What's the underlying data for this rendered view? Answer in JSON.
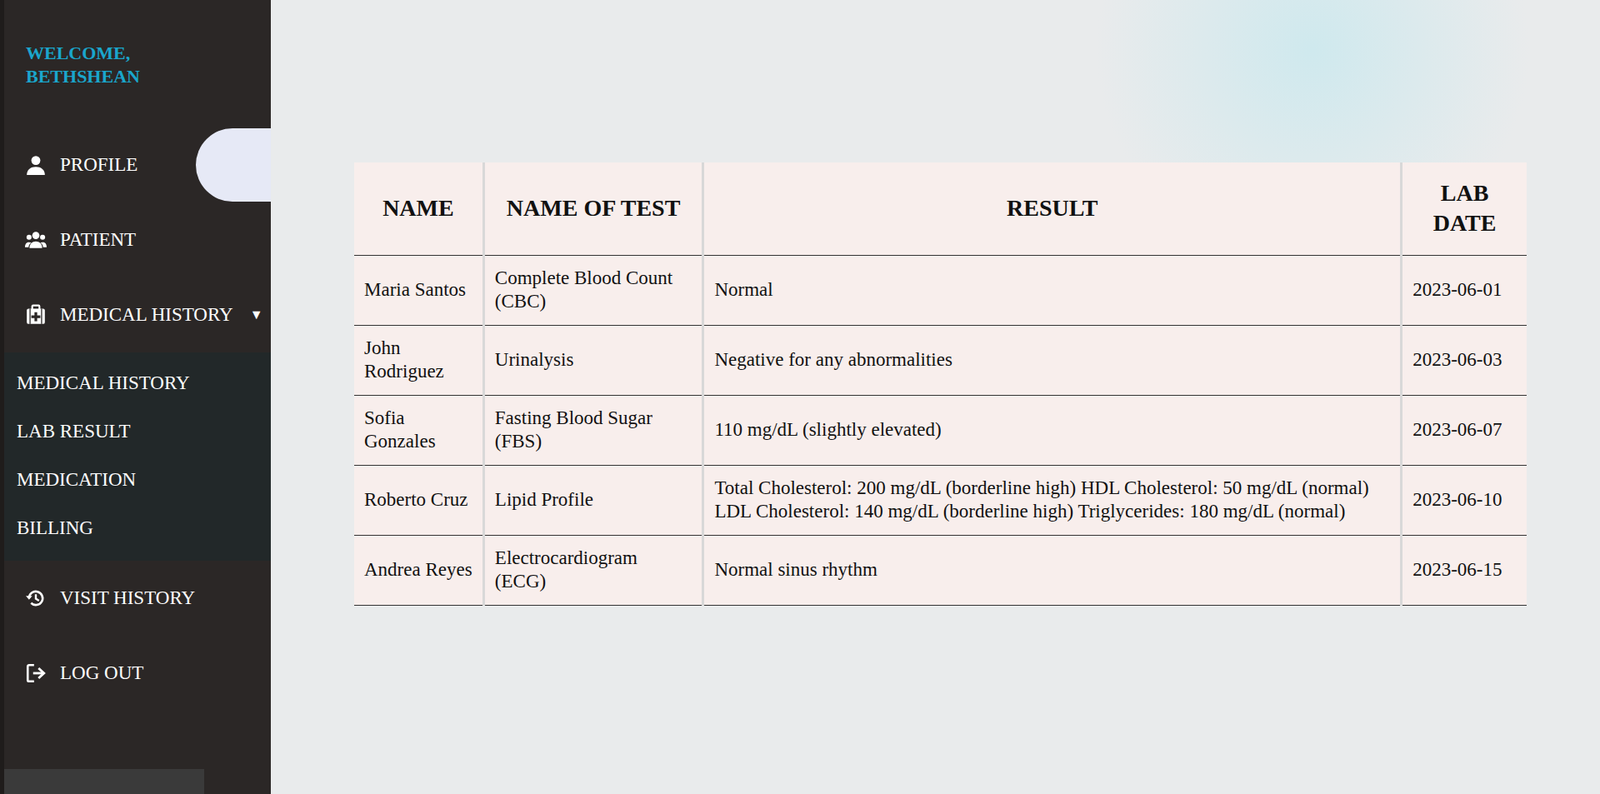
{
  "sidebar": {
    "welcome": "WELCOME, BETHSHEAN",
    "items": [
      {
        "label": "PROFILE",
        "selected": true
      },
      {
        "label": "PATIENT",
        "selected": false
      },
      {
        "label": "MEDICAL HISTORY",
        "selected": false,
        "expanded": true,
        "children": [
          "MEDICAL HISTORY",
          "LAB RESULT",
          "MEDICATION",
          "BILLING"
        ]
      },
      {
        "label": "VISIT HISTORY",
        "selected": false
      },
      {
        "label": "LOG OUT",
        "selected": false
      }
    ]
  },
  "table": {
    "columns": [
      "NAME",
      "NAME OF TEST",
      "RESULT",
      "LAB DATE"
    ],
    "rows": [
      [
        "Maria Santos",
        "Complete Blood Count (CBC)",
        "Normal",
        "2023-06-01"
      ],
      [
        "John Rodriguez",
        "Urinalysis",
        "Negative for any abnormalities",
        "2023-06-03"
      ],
      [
        "Sofia Gonzales",
        "Fasting Blood Sugar (FBS)",
        "110 mg/dL (slightly elevated)",
        "2023-06-07"
      ],
      [
        "Roberto Cruz",
        "Lipid Profile",
        "Total Cholesterol: 200 mg/dL (borderline high) HDL Cholesterol: 50 mg/dL (normal) LDL Cholesterol: 140 mg/dL (borderline high) Triglycerides: 180 mg/dL (normal)",
        "2023-06-10"
      ],
      [
        "Andrea Reyes",
        "Electrocardiogram (ECG)",
        "Normal sinus rhythm",
        "2023-06-15"
      ]
    ]
  }
}
